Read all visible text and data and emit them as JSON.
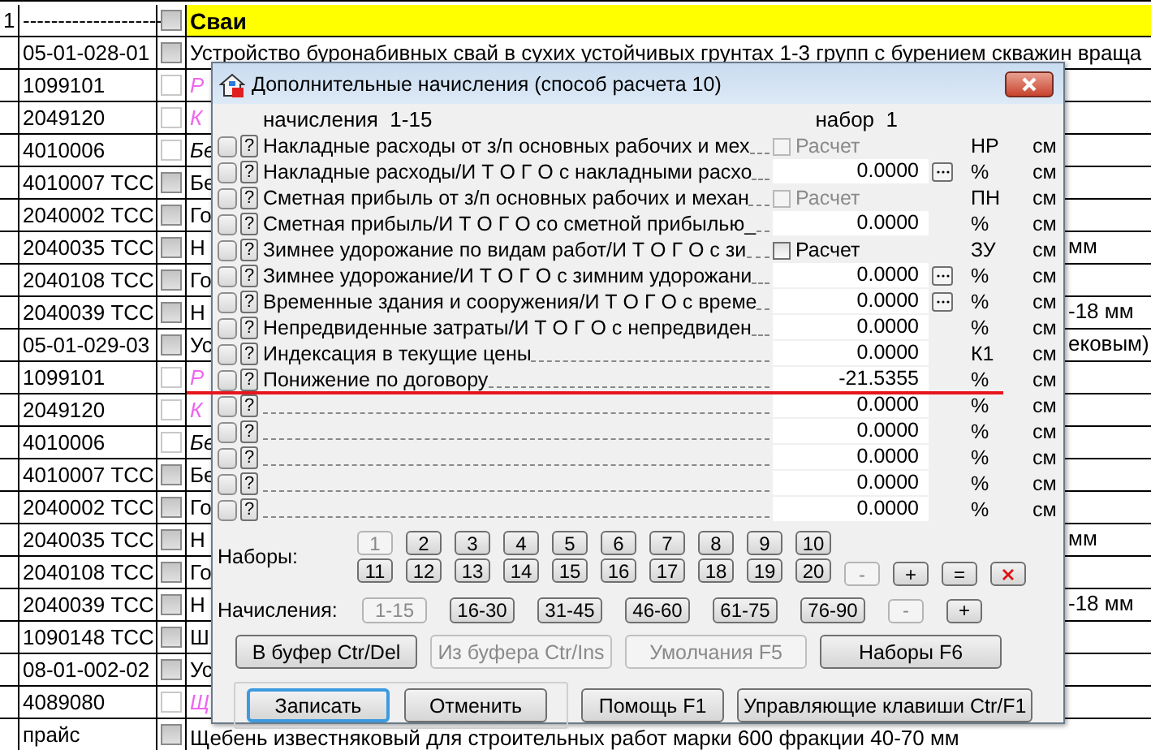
{
  "sheet": {
    "rows": [
      {
        "number": "1",
        "code": "--------------------",
        "checked": true,
        "kind": "section",
        "description": "Сваи"
      },
      {
        "code": "05-01-028-01",
        "checked": true,
        "kind": "item",
        "description": "Устройство буронабивных свай в сухих устойчивых грунтах 1-3 групп с бурением скважин враща"
      },
      {
        "code": "1099101",
        "checked": false,
        "kind": "resource",
        "description": "Р"
      },
      {
        "code": "2049120",
        "checked": false,
        "kind": "resource",
        "description": "К"
      },
      {
        "code": "4010006",
        "checked": false,
        "kind": "note",
        "description": "Бе"
      },
      {
        "code": "4010007 ТСС",
        "checked": true,
        "kind": "item",
        "description": "Бе"
      },
      {
        "code": "2040002 ТСС",
        "checked": true,
        "kind": "item",
        "description": "Го"
      },
      {
        "code": "2040035 ТСС",
        "checked": true,
        "kind": "item",
        "description": "Н",
        "tail": "мм"
      },
      {
        "code": "2040108 ТСС",
        "checked": true,
        "kind": "item",
        "description": "Го"
      },
      {
        "code": "2040039 ТСС",
        "checked": true,
        "kind": "item",
        "description": "Н",
        "tail": "-18 мм"
      },
      {
        "code": "05-01-029-03",
        "checked": true,
        "kind": "item",
        "description": "Ус",
        "tail": "ековым)"
      },
      {
        "code": "1099101",
        "checked": false,
        "kind": "resource",
        "description": "Р"
      },
      {
        "code": "2049120",
        "checked": false,
        "kind": "resource",
        "description": "К"
      },
      {
        "code": "4010006",
        "checked": false,
        "kind": "note",
        "description": "Бе"
      },
      {
        "code": "4010007 ТСС",
        "checked": true,
        "kind": "item",
        "description": "Бе"
      },
      {
        "code": "2040002 ТСС",
        "checked": true,
        "kind": "item",
        "description": "Го"
      },
      {
        "code": "2040035 ТСС",
        "checked": true,
        "kind": "item",
        "description": "Н",
        "tail": "мм"
      },
      {
        "code": "2040108 ТСС",
        "checked": true,
        "kind": "item",
        "description": "Го"
      },
      {
        "code": "2040039 ТСС",
        "checked": true,
        "kind": "item",
        "description": "Н",
        "tail": "-18 мм"
      },
      {
        "code": "1090148 ТСС",
        "checked": true,
        "kind": "item",
        "description": "Ш"
      },
      {
        "code": "08-01-002-02",
        "checked": true,
        "kind": "item",
        "description": "Ус"
      },
      {
        "code": "4089080",
        "checked": false,
        "kind": "resource",
        "description": "Щ"
      },
      {
        "code": "прайс",
        "checked": true,
        "kind": "item",
        "description": "Щебень известняковый для строительных работ марки 600 фракции 40-70 мм"
      }
    ]
  },
  "dialog": {
    "title": "Дополнительные начисления (способ расчета 10)",
    "header_left": "начисления  1-15",
    "header_right": "набор  1",
    "rows": [
      {
        "help": "?",
        "label": "Накладные расходы от з/п основных рабочих и мех",
        "kind": "calc",
        "calc_label": "Расчет",
        "checked": false,
        "disabled": true,
        "unit": "НР",
        "measure": "см"
      },
      {
        "help": "?",
        "label": "Накладные расходы/И Т О Г О с накладными расхо",
        "kind": "value",
        "value": "0.0000",
        "more": true,
        "unit": "%",
        "measure": "см"
      },
      {
        "help": "?",
        "label": "Сметная прибыль от з/п основных рабочих и механ",
        "kind": "calc",
        "calc_label": "Расчет",
        "checked": false,
        "disabled": true,
        "unit": "ПН",
        "measure": "см"
      },
      {
        "help": "?",
        "label": "Сметная прибыль/И Т О Г О со сметной прибылью_",
        "kind": "value",
        "value": "0.0000",
        "more": false,
        "unit": "%",
        "measure": "см"
      },
      {
        "help": "?",
        "label": "Зимнее удорожание по видам работ/И Т О Г О с зи",
        "kind": "calc",
        "calc_label": "Расчет",
        "checked": false,
        "disabled": false,
        "unit": "ЗУ",
        "measure": "см"
      },
      {
        "help": "?",
        "label": "Зимнее удорожание/И Т О Г О с зимним удорожани",
        "kind": "value",
        "value": "0.0000",
        "more": true,
        "unit": "%",
        "measure": "см"
      },
      {
        "help": "?",
        "label": "Временные здания и сооружения/И Т О Г О с време",
        "kind": "value",
        "value": "0.0000",
        "more": true,
        "unit": "%",
        "measure": "см"
      },
      {
        "help": "?",
        "label": "Непредвиденные затраты/И Т О Г О с непредвиден",
        "kind": "value",
        "value": "0.0000",
        "more": false,
        "unit": "%",
        "measure": "см"
      },
      {
        "help": "?",
        "label": "Индексация в текущие цены",
        "kind": "value",
        "value": "0.0000",
        "more": false,
        "unit": "К1",
        "measure": "см"
      },
      {
        "help": "?",
        "label": "Понижение по договору",
        "kind": "value",
        "value": "-21.5355",
        "more": false,
        "unit": "%",
        "measure": "см"
      },
      {
        "help": "?",
        "kind": "value",
        "value": "0.0000",
        "more": false,
        "unit": "%",
        "measure": "см"
      },
      {
        "help": "?",
        "kind": "value",
        "value": "0.0000",
        "more": false,
        "unit": "%",
        "measure": "см"
      },
      {
        "help": "?",
        "kind": "value",
        "value": "0.0000",
        "more": false,
        "unit": "%",
        "measure": "см"
      },
      {
        "help": "?",
        "kind": "value",
        "value": "0.0000",
        "more": false,
        "unit": "%",
        "measure": "см"
      },
      {
        "help": "?",
        "kind": "value",
        "value": "0.0000",
        "more": false,
        "unit": "%",
        "measure": "см"
      }
    ],
    "sets_label": "Наборы:",
    "sets": [
      {
        "label": "1",
        "selected": true
      },
      {
        "label": "2",
        "selected": false
      },
      {
        "label": "3",
        "selected": false
      },
      {
        "label": "4",
        "selected": false
      },
      {
        "label": "5",
        "selected": false
      },
      {
        "label": "6",
        "selected": false
      },
      {
        "label": "7",
        "selected": false
      },
      {
        "label": "8",
        "selected": false
      },
      {
        "label": "9",
        "selected": false
      },
      {
        "label": "10",
        "selected": false
      },
      {
        "label": "11",
        "selected": false
      },
      {
        "label": "12",
        "selected": false
      },
      {
        "label": "13",
        "selected": false
      },
      {
        "label": "14",
        "selected": false
      },
      {
        "label": "15",
        "selected": false
      },
      {
        "label": "16",
        "selected": false
      },
      {
        "label": "17",
        "selected": false
      },
      {
        "label": "18",
        "selected": false
      },
      {
        "label": "19",
        "selected": false
      },
      {
        "label": "20",
        "selected": false
      }
    ],
    "set_actions": [
      {
        "kind": "text",
        "label": "-",
        "disabled": true
      },
      {
        "kind": "text",
        "label": "+",
        "disabled": false
      },
      {
        "kind": "text",
        "label": "=",
        "disabled": false
      },
      {
        "kind": "delete",
        "disabled": false
      }
    ],
    "ranges_label": "Начисления:",
    "ranges": [
      {
        "label": "1-15",
        "selected": true
      },
      {
        "label": "16-30",
        "selected": false
      },
      {
        "label": "31-45",
        "selected": false
      },
      {
        "label": "46-60",
        "selected": false
      },
      {
        "label": "61-75",
        "selected": false
      },
      {
        "label": "76-90",
        "selected": false
      }
    ],
    "range_actions": [
      {
        "label": "-",
        "disabled": true
      },
      {
        "label": "+",
        "disabled": false
      }
    ],
    "tools": [
      {
        "label": "В буфер Ctr/Del",
        "disabled": false
      },
      {
        "label": "Из буфера Ctr/Ins",
        "disabled": true
      },
      {
        "label": "Умолчания F5",
        "disabled": true
      },
      {
        "label": "Наборы F6",
        "disabled": false
      }
    ],
    "buttons": [
      {
        "label": "Записать",
        "default": true
      },
      {
        "label": "Отменить",
        "default": false
      }
    ],
    "help_buttons": [
      {
        "label": "Помощь F1"
      },
      {
        "label": "Управляющие клавиши Ctr/F1"
      }
    ]
  }
}
